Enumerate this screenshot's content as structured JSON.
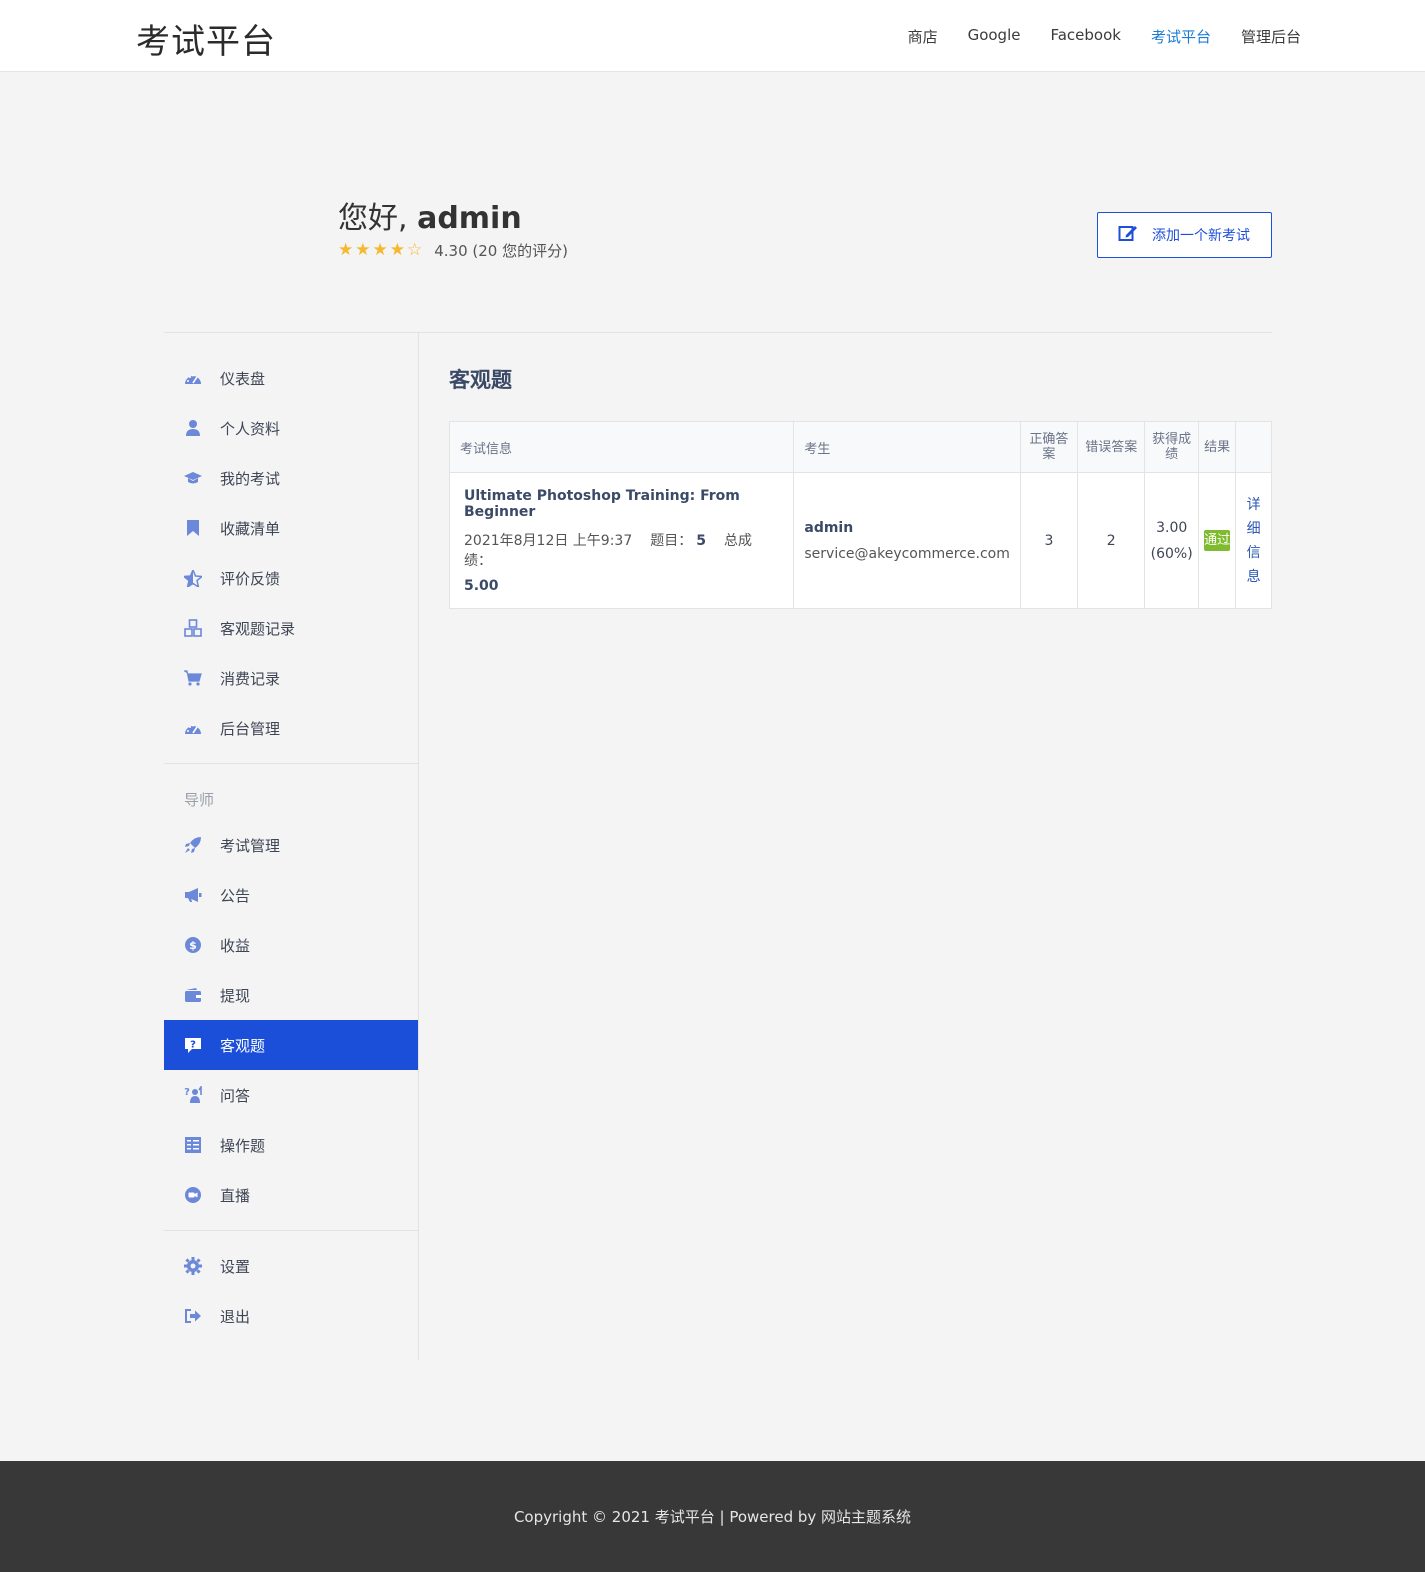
{
  "header": {
    "site_title": "考试平台",
    "nav": [
      "商店",
      "Google",
      "Facebook",
      "考试平台",
      "管理后台"
    ]
  },
  "profile": {
    "greeting_prefix": "您好, ",
    "username": "admin",
    "rating_value": 4.3,
    "rating_text": "4.30 (20 您的评分)",
    "add_button": "添加一个新考试"
  },
  "sidebar": {
    "items": [
      "仪表盘",
      "个人资料",
      "我的考试",
      "收藏清单",
      "评价反馈",
      "客观题记录",
      "消费记录",
      "后台管理"
    ],
    "instructor_heading": "导师",
    "instructor_items": [
      "考试管理",
      "公告",
      "收益",
      "提现",
      "客观题",
      "问答",
      "操作题",
      "直播"
    ],
    "bottom_items": [
      "设置",
      "退出"
    ],
    "active": "客观题"
  },
  "main": {
    "title": "客观题",
    "table": {
      "headers": [
        "考试信息",
        "考生",
        "正确答案",
        "错误答案",
        "获得成绩",
        "结果",
        ""
      ],
      "rows": [
        {
          "exam_title": "Ultimate Photoshop Training: From Beginner",
          "date": "2021年8月12日 上午9:37",
          "questions_label": "题目：",
          "questions_value": "5",
          "total_label": "总成绩：",
          "total_value": "5.00",
          "student_name": "admin",
          "student_email": "service@akeycommerce.com",
          "correct": "3",
          "wrong": "2",
          "score": "3.00",
          "score_pct": "(60%)",
          "result": "通过",
          "details": "详细信息"
        }
      ]
    }
  },
  "footer": {
    "text": "Copyright © 2021 考试平台 | Powered by 网站主题系统"
  },
  "colors": {
    "accent": "#1b4fd9",
    "link": "#1d7bd6",
    "pass": "#7fbb2e",
    "star": "#f5b82e",
    "footer_bg": "#383838"
  }
}
